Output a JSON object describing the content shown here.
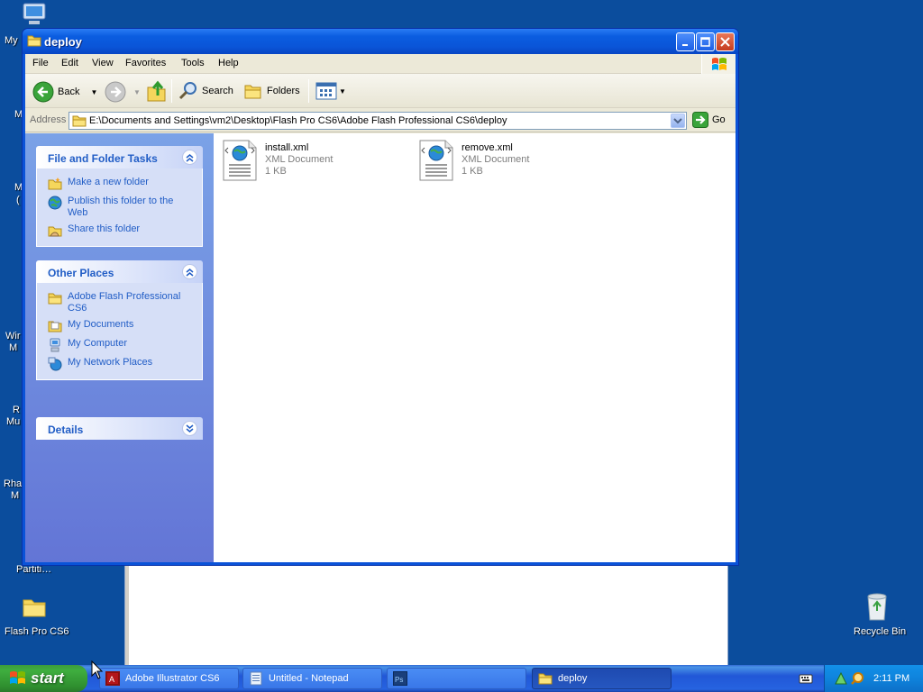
{
  "desktop": {
    "labels": [
      "My",
      "M",
      "M",
      "(",
      "Wir",
      "M",
      "R",
      "Mu",
      "Rha",
      "M",
      "Partiti…"
    ],
    "flash_folder": "Flash Pro CS6",
    "recycle_bin": "Recycle Bin"
  },
  "window": {
    "title": "deploy",
    "menu": [
      "File",
      "Edit",
      "View",
      "Favorites",
      "Tools",
      "Help"
    ],
    "toolbar": {
      "back": "Back",
      "search": "Search",
      "folders": "Folders"
    },
    "address": {
      "label": "Address",
      "path": "E:\\Documents and Settings\\vm2\\Desktop\\Flash Pro CS6\\Adobe Flash Professional CS6\\deploy",
      "go": "Go"
    }
  },
  "leftpane": {
    "file_tasks": {
      "title": "File and Folder Tasks",
      "items": [
        "Make a new folder",
        "Publish this folder to the Web",
        "Share this folder"
      ]
    },
    "other_places": {
      "title": "Other Places",
      "items": [
        "Adobe Flash Professional CS6",
        "My Documents",
        "My Computer",
        "My Network Places"
      ]
    },
    "details": {
      "title": "Details"
    }
  },
  "files": [
    {
      "name": "install.xml",
      "type": "XML Document",
      "size": "1 KB"
    },
    {
      "name": "remove.xml",
      "type": "XML Document",
      "size": "1 KB"
    }
  ],
  "taskbar": {
    "start": "start",
    "buttons": [
      "Adobe Illustrator CS6",
      "Untitled - Notepad",
      "",
      "deploy"
    ],
    "clock": "2:11 PM"
  },
  "colors": {
    "desktop": "#0b4d9d",
    "titlebar": "#0a55d8",
    "link": "#215dc6",
    "start_green": "#3fae3f"
  }
}
